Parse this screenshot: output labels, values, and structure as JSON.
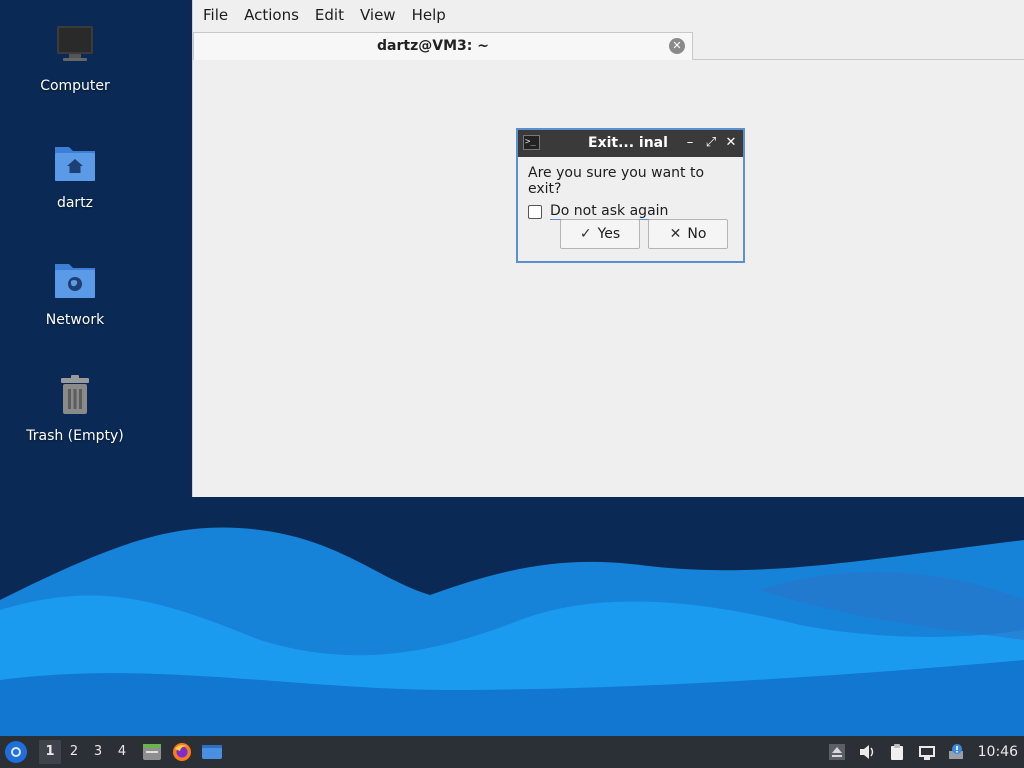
{
  "desktop": {
    "icons": [
      {
        "label": "Computer"
      },
      {
        "label": "dartz"
      },
      {
        "label": "Network"
      },
      {
        "label": "Trash (Empty)"
      }
    ]
  },
  "terminal": {
    "menu": [
      "File",
      "Actions",
      "Edit",
      "View",
      "Help"
    ],
    "tab_title": "dartz@VM3: ~",
    "tab_close_glyph": "✕"
  },
  "dialog": {
    "title": "Exit... inal",
    "question": "Are you sure you want to exit?",
    "checkbox_label": "Do not ask again",
    "checkbox_checked": false,
    "yes_label": "Yes",
    "no_label": "No",
    "yes_glyph": "✓",
    "no_glyph": "✕",
    "minimize_glyph": "–",
    "maximize_glyph": "⤢",
    "close_glyph": "✕"
  },
  "taskbar": {
    "workspaces": [
      "1",
      "2",
      "3",
      "4"
    ],
    "active_workspace": "1",
    "clock": "10:46"
  },
  "colors": {
    "accent": "#5a8fd0",
    "wallpaper_dark": "#0a2a55",
    "wave_light": "#1a9bf0",
    "taskbar": "#2b2f36"
  }
}
